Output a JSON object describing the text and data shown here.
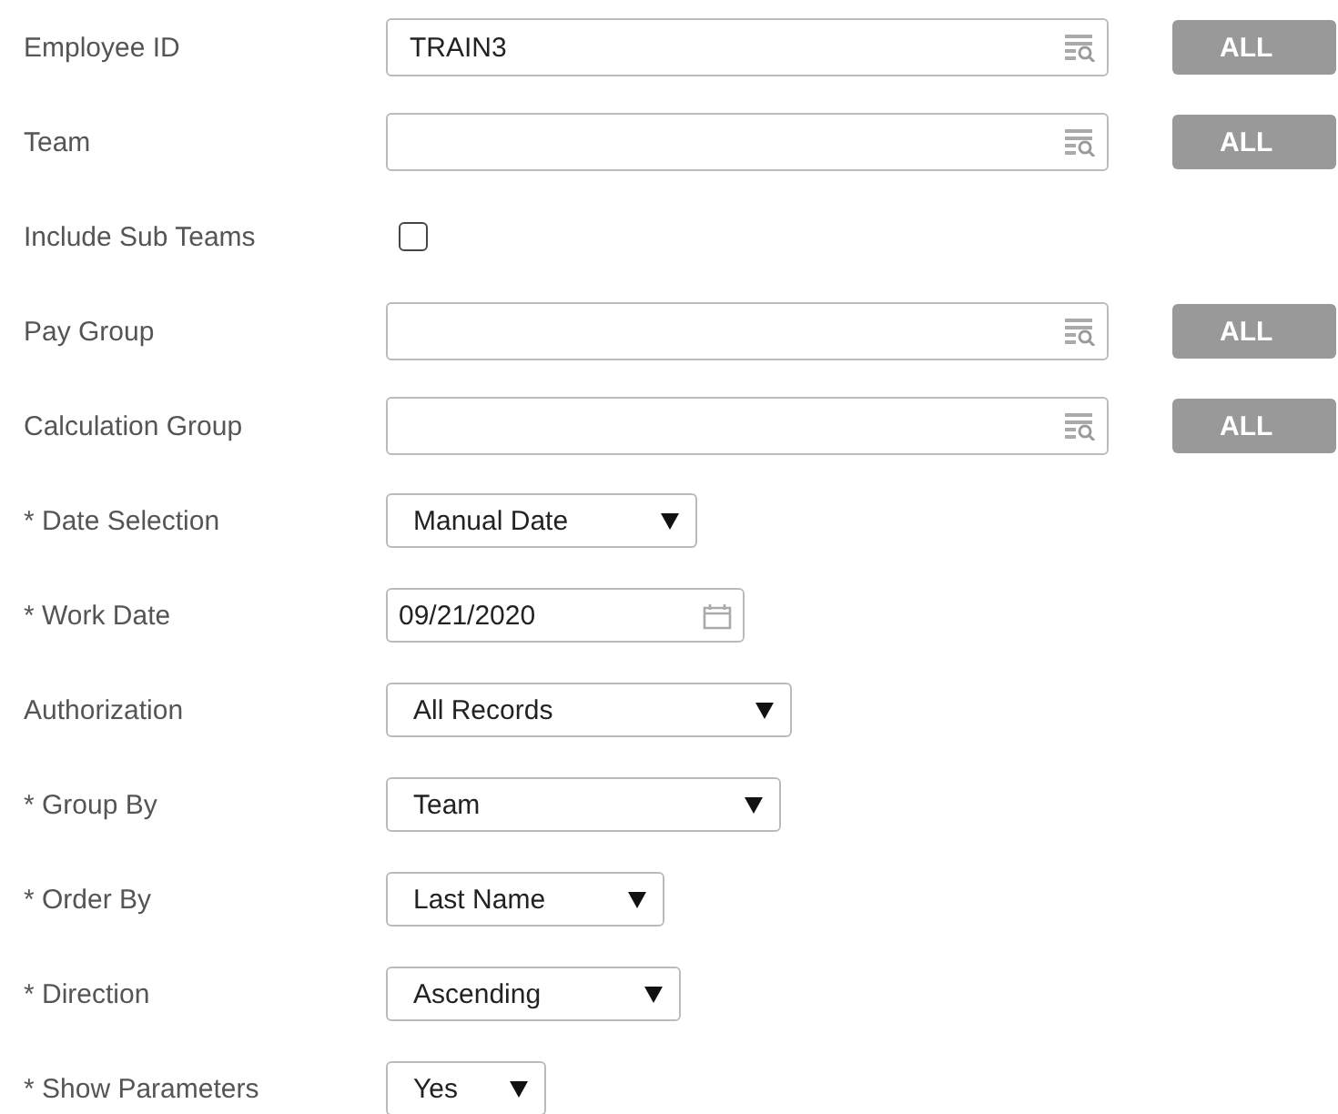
{
  "fields": [
    {
      "kind": "lookup",
      "label": "Employee ID",
      "value": "TRAIN3",
      "all_button": "ALL"
    },
    {
      "kind": "lookup",
      "label": "Team",
      "all_button": "ALL"
    },
    {
      "kind": "checkbox",
      "label": "Include Sub Teams",
      "checked": false
    },
    {
      "kind": "lookup",
      "label": "Pay Group",
      "all_button": "ALL"
    },
    {
      "kind": "lookup",
      "label": "Calculation Group",
      "all_button": "ALL"
    },
    {
      "kind": "select",
      "label": "* Date Selection",
      "value": "Manual Date"
    },
    {
      "kind": "date",
      "label": "* Work Date",
      "value": "09/21/2020"
    },
    {
      "kind": "select",
      "label": "Authorization",
      "value": "All Records"
    },
    {
      "kind": "select",
      "label": "* Group By",
      "value": "Team"
    },
    {
      "kind": "select",
      "label": "* Order By",
      "value": "Last Name"
    },
    {
      "kind": "select",
      "label": "* Direction",
      "value": "Ascending"
    },
    {
      "kind": "select",
      "label": "* Show Parameters",
      "value": "Yes"
    }
  ]
}
